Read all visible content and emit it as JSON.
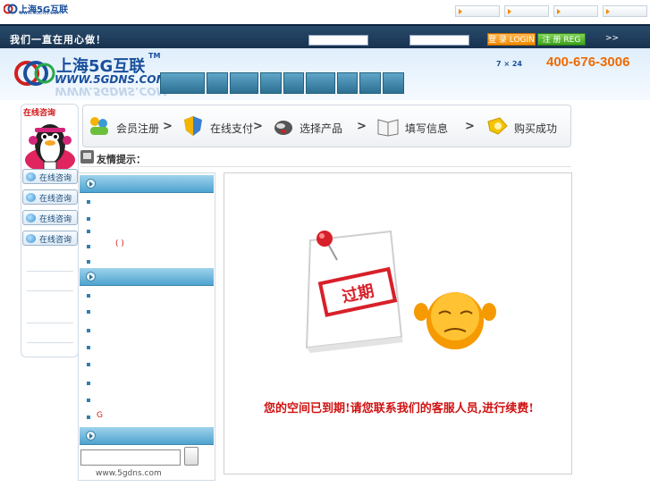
{
  "topbar": {
    "small_logo": {
      "name": "上海5G互联",
      "url": "WWW.5GDNS.COM"
    },
    "links": [
      "",
      "",
      "",
      ""
    ]
  },
  "navbar": {
    "slogan": "我们一直在用心做！",
    "username_value": "",
    "password_value": "",
    "login_label": "登 录 LOGIN",
    "register_label": "注 册 REG",
    "more_label": ">>"
  },
  "logo_row": {
    "title": "上海5G互联",
    "tm": "TM",
    "url": "WWW.5GDNS.COM",
    "service_hours": "7 × 24",
    "phone": "400-676-3006"
  },
  "online_panel": {
    "title": "在线咨询",
    "buttons": [
      "在线咨询",
      "在线咨询",
      "在线咨询",
      "在线咨询"
    ]
  },
  "steps": {
    "items": [
      "会员注册",
      "在线支付",
      "选择产品",
      "填写信息",
      "购买成功"
    ],
    "arrow": ">"
  },
  "tips": {
    "label": "友情提示："
  },
  "midcol": {
    "red_paren": "( )",
    "red_g": "G",
    "search_value": "",
    "site_url": "www.5gdns.com"
  },
  "main": {
    "stamp_text": "过期",
    "message": "您的空间已到期!请您联系我们的客服人员,进行续费!"
  },
  "colors": {
    "navy": "#18324f",
    "accent_orange": "#f06a00",
    "brand_blue": "#1a4f9c",
    "alert_red": "#d01212"
  }
}
